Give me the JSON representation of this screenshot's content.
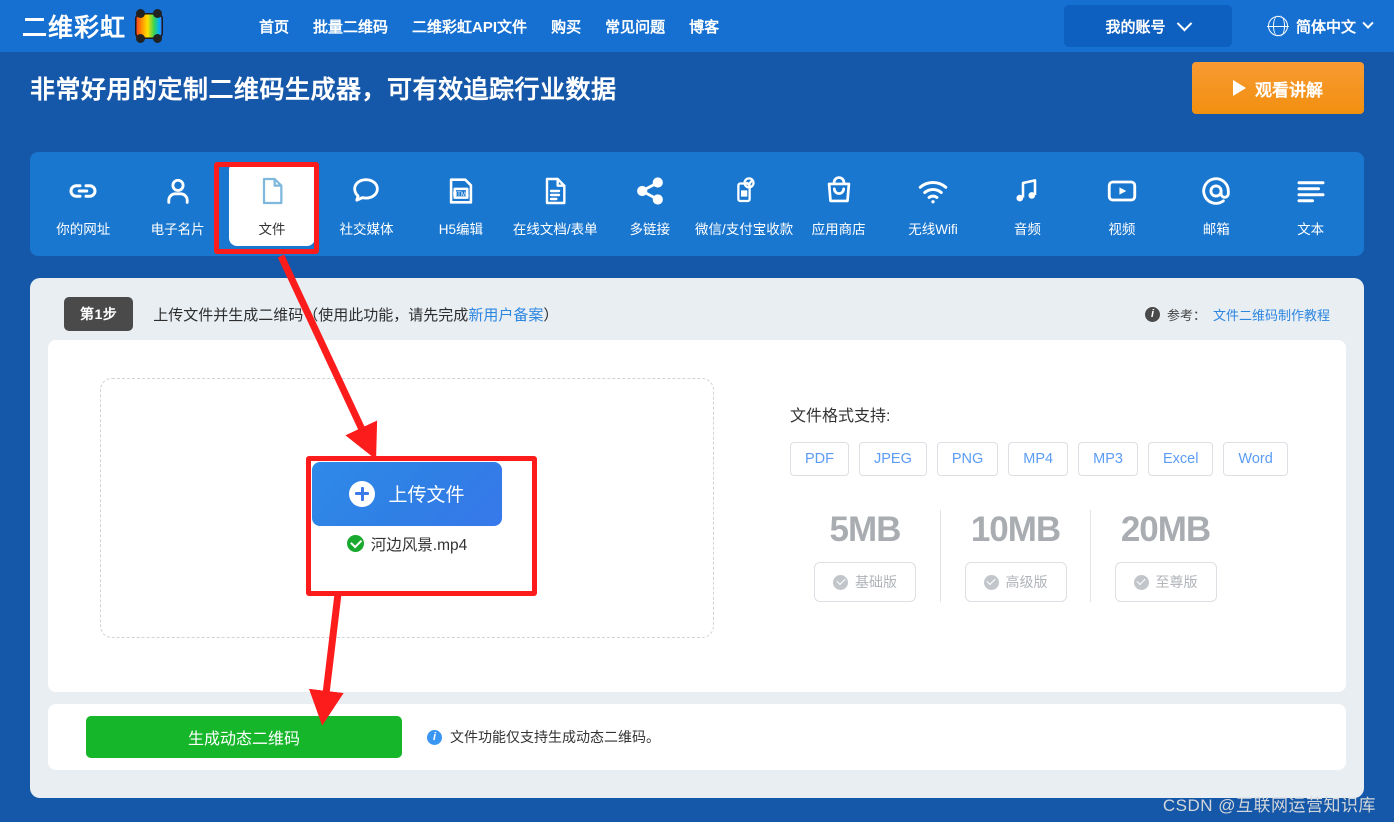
{
  "header": {
    "brand": "二维彩虹",
    "brand_icon": "rainbow-bear-logo",
    "menu": [
      {
        "label": "首页"
      },
      {
        "label": "批量二维码"
      },
      {
        "label": "二维彩虹API文件"
      },
      {
        "label": "购买"
      },
      {
        "label": "常见问题"
      },
      {
        "label": "博客"
      }
    ],
    "account_label": "我的账号",
    "language_label": "简体中文",
    "colors": {
      "nav_bg": "#1570d1",
      "page_bg": "#1557a8",
      "account_btn": "#0d5fc0"
    }
  },
  "hero": {
    "title": "非常好用的定制二维码生成器，可有效追踪行业数据",
    "watch_button": "观看讲解",
    "watch_button_color": "#f2900f"
  },
  "type_tabs": {
    "active_index": 2,
    "items": [
      {
        "label": "你的网址",
        "icon": "link-icon"
      },
      {
        "label": "电子名片",
        "icon": "person-icon"
      },
      {
        "label": "文件",
        "icon": "file-icon"
      },
      {
        "label": "社交媒体",
        "icon": "chat-bubble-icon"
      },
      {
        "label": "H5编辑",
        "icon": "html-page-icon"
      },
      {
        "label": "在线文档/表单",
        "icon": "document-lines-icon"
      },
      {
        "label": "多链接",
        "icon": "share-nodes-icon"
      },
      {
        "label": "微信/支付宝收款",
        "icon": "payment-qr-icon"
      },
      {
        "label": "应用商店",
        "icon": "shopping-bag-icon"
      },
      {
        "label": "无线Wifi",
        "icon": "wifi-icon"
      },
      {
        "label": "音频",
        "icon": "music-note-icon"
      },
      {
        "label": "视频",
        "icon": "video-play-icon"
      },
      {
        "label": "邮箱",
        "icon": "at-sign-icon"
      },
      {
        "label": "文本",
        "icon": "text-lines-icon"
      }
    ]
  },
  "step": {
    "badge": "第1步",
    "text_before": "上传文件并生成二维码（使用此功能，请先完成",
    "link": "新用户备案",
    "text_after": "）",
    "reference_label": "参考：",
    "reference_link": "文件二维码制作教程"
  },
  "upload": {
    "button_label": "上传文件",
    "file_name": "河边风景.mp4",
    "file_status_icon": "green-check-icon"
  },
  "formats": {
    "title": "文件格式支持:",
    "chips": [
      "PDF",
      "JPEG",
      "PNG",
      "MP4",
      "MP3",
      "Excel",
      "Word"
    ],
    "tiers": [
      {
        "size": "5MB",
        "plan": "基础版"
      },
      {
        "size": "10MB",
        "plan": "高级版"
      },
      {
        "size": "20MB",
        "plan": "至尊版"
      }
    ]
  },
  "bottom": {
    "generate_label": "生成动态二维码",
    "generate_color": "#16b62b",
    "note": "文件功能仅支持生成动态二维码。"
  },
  "watermark": "CSDN @互联网运营知识库"
}
